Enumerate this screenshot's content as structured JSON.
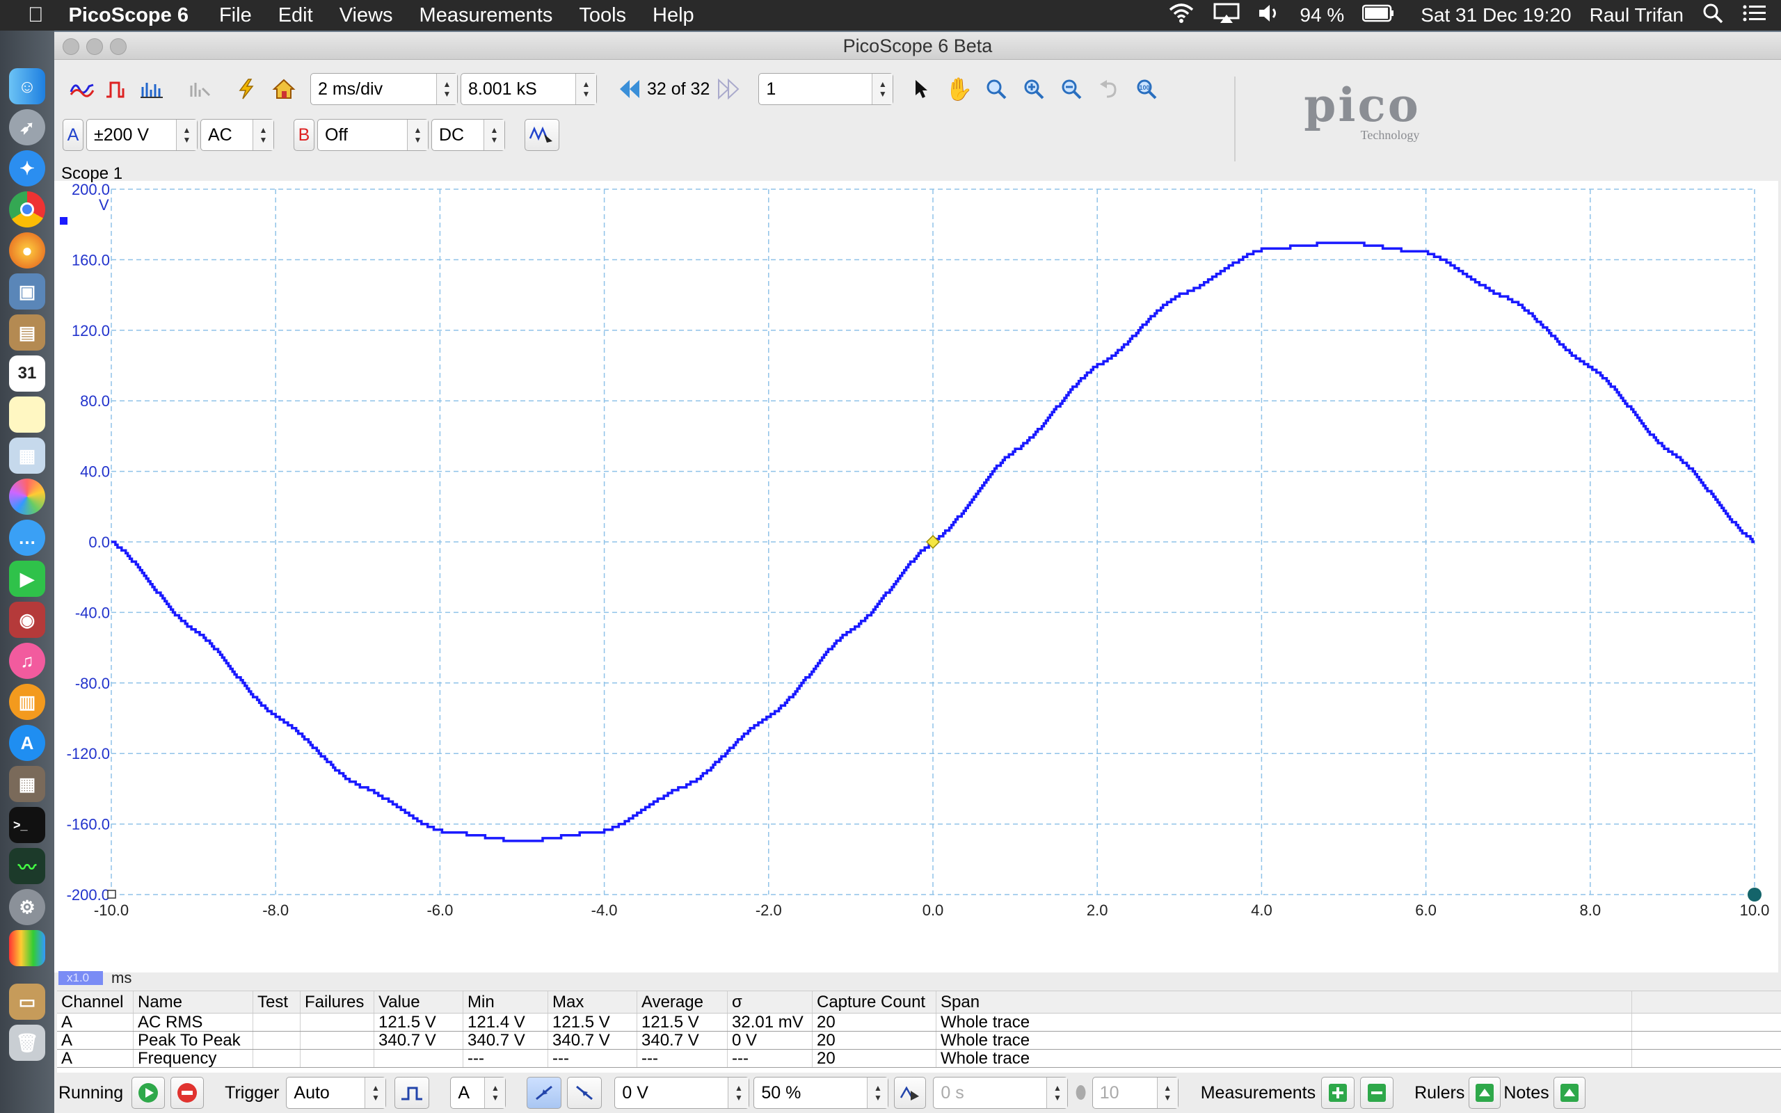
{
  "menubar": {
    "app_name": "PicoScope 6",
    "items": [
      "File",
      "Edit",
      "Views",
      "Measurements",
      "Tools",
      "Help"
    ],
    "battery": "94 %",
    "datetime": "Sat 31 Dec  19:20",
    "user": "Raul Trifan"
  },
  "window": {
    "title": "PicoScope 6 Beta"
  },
  "toolbar": {
    "timebase": "2 ms/div",
    "samples": "8.001 kS",
    "capture_nav": "32 of 32",
    "capture_count": "1"
  },
  "channels": {
    "a": {
      "label": "A",
      "range": "±200 V",
      "coupling": "AC"
    },
    "b": {
      "label": "B",
      "range": "Off",
      "coupling": "DC"
    }
  },
  "logo": {
    "text": "pico",
    "sub": "Technology"
  },
  "scope": {
    "tab_label": "Scope 1",
    "y_unit": "V",
    "x_unit": "ms",
    "zoom": "x1.0"
  },
  "chart_data": {
    "type": "line",
    "x_ticks": [
      "-10.0",
      "-8.0",
      "-6.0",
      "-4.0",
      "-2.0",
      "0.0",
      "2.0",
      "4.0",
      "6.0",
      "8.0",
      "10.0"
    ],
    "y_ticks": [
      "200.0",
      "160.0",
      "120.0",
      "80.0",
      "40.0",
      "0.0",
      "-40.0",
      "-80.0",
      "-120.0",
      "-160.0",
      "-200.0"
    ],
    "xlim": [
      -10,
      10
    ],
    "ylim": [
      -200,
      200
    ],
    "grid": true,
    "series": [
      {
        "x": [
          -10,
          -9,
          -8,
          -7,
          -6,
          -5,
          -4,
          -3,
          -2,
          -1,
          0,
          1,
          2,
          3,
          4,
          5,
          6,
          7,
          8,
          9,
          10
        ],
        "y": [
          0,
          -50,
          -99,
          -138,
          -164,
          -170,
          -164,
          -138,
          -99,
          -50,
          0,
          52,
          100,
          140,
          166,
          170,
          164,
          138,
          99,
          50,
          0
        ]
      }
    ],
    "color": "#1a1aff",
    "trigger_marker": {
      "x": 0,
      "y": 0
    }
  },
  "measurements": {
    "headers": [
      "Channel",
      "Name",
      "Test",
      "Failures",
      "Value",
      "Min",
      "Max",
      "Average",
      "σ",
      "Capture Count",
      "Span"
    ],
    "rows": [
      [
        "A",
        "AC RMS",
        "",
        "",
        "121.5 V",
        "121.4 V",
        "121.5 V",
        "121.5 V",
        "32.01 mV",
        "20",
        "Whole trace"
      ],
      [
        "A",
        "Peak To Peak",
        "",
        "",
        "340.7 V",
        "340.7 V",
        "340.7 V",
        "340.7 V",
        "0 V",
        "20",
        "Whole trace"
      ],
      [
        "A",
        "Frequency",
        "",
        "",
        "",
        "---",
        "---",
        "---",
        "---",
        "20",
        "Whole trace"
      ]
    ]
  },
  "statusbar": {
    "running": "Running",
    "trigger_label": "Trigger",
    "trigger_mode": "Auto",
    "trigger_channel": "A",
    "threshold": "0 V",
    "pre_trigger": "50 %",
    "delay": "0 s",
    "holdoff": "10",
    "measurements_label": "Measurements",
    "rulers_label": "Rulers",
    "notes_label": "Notes"
  }
}
